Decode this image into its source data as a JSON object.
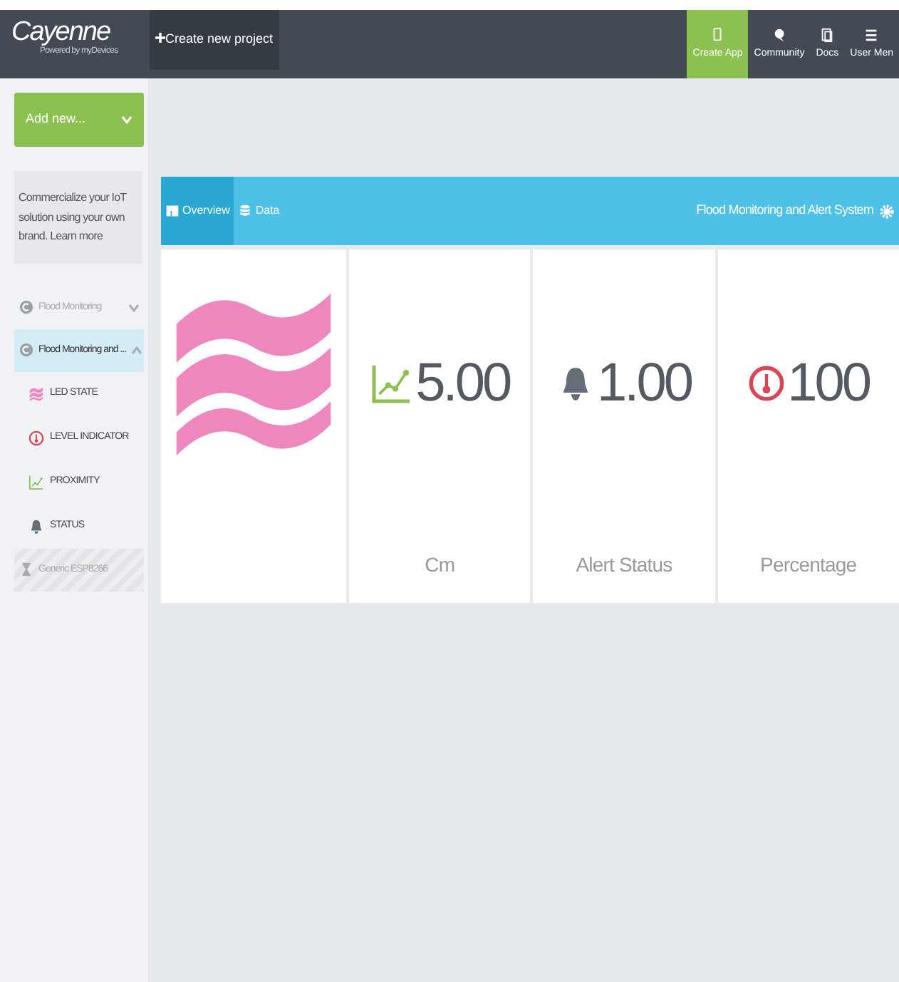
{
  "header": {
    "logo": "Cayenne",
    "logo_sub": "Powered by myDevices",
    "create_button": "Create new project",
    "nav": [
      {
        "label": "Create App",
        "kind": "app",
        "selected": true
      },
      {
        "label": "Community",
        "kind": "community",
        "selected": false
      },
      {
        "label": "Docs",
        "kind": "docs",
        "selected": false
      },
      {
        "label": "User Men",
        "kind": "menu",
        "selected": false
      }
    ]
  },
  "sidebar": {
    "add_button": "Add new...",
    "promo": "Commercialize your IoT solution using your own brand.",
    "promo_link": "Learn more",
    "devices": [
      {
        "name": "Flood Monitoring",
        "expanded": false,
        "selected": false,
        "disabled": false
      },
      {
        "name": "Flood Monitoring and ...",
        "expanded": true,
        "selected": true,
        "disabled": false,
        "children": [
          {
            "label": "LED STATE",
            "kind": "waves"
          },
          {
            "label": "LEVEL INDICATOR",
            "kind": "gauge"
          },
          {
            "label": "PROXIMITY",
            "kind": "chart"
          },
          {
            "label": "STATUS",
            "kind": "bell"
          }
        ]
      },
      {
        "name": "Generic ESP8266",
        "disabled": true,
        "selected": false
      }
    ]
  },
  "project": {
    "tabs": [
      {
        "label": "Overview",
        "kind": "overview",
        "selected": true
      },
      {
        "label": "Data",
        "kind": "data",
        "selected": false
      }
    ],
    "title": "Flood Monitoring and Alert System",
    "widgets": [
      {
        "kind": "waves"
      },
      {
        "kind": "chart",
        "value": "5.00",
        "label": "Cm"
      },
      {
        "kind": "bell",
        "value": "1.00",
        "label": "Alert Status"
      },
      {
        "kind": "gauge",
        "value": "100",
        "label": "Percentage"
      }
    ]
  }
}
